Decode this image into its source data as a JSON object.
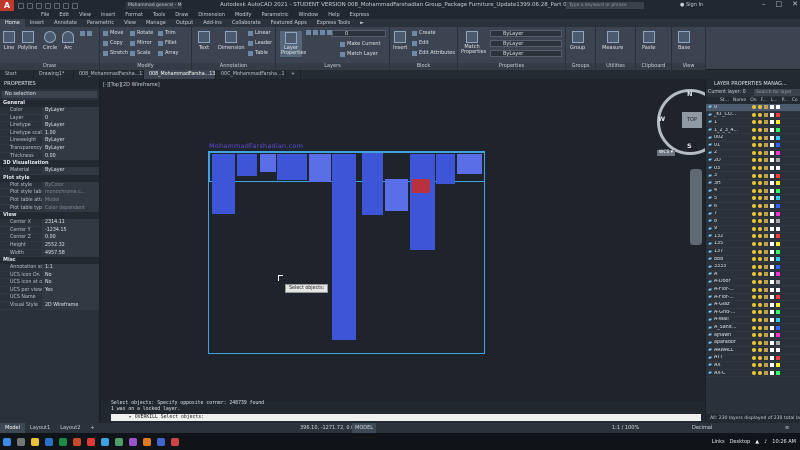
{
  "app": {
    "logo": "A",
    "title": "Autodesk AutoCAD 2021 - STUDENT VERSION    008_MohammadFarshadian Group_Package Furniture_Update1399.06.28_Part 02.dwg",
    "search_placeholder": "Type a keyword or phrase",
    "signin": "Sign In",
    "workspace": "Mohammad general - Mi..."
  },
  "menu": [
    "File",
    "Edit",
    "View",
    "Insert",
    "Format",
    "Tools",
    "Draw",
    "Dimension",
    "Modify",
    "Parametric",
    "Window",
    "Help",
    "Express"
  ],
  "ribbon_tabs": [
    "Home",
    "Insert",
    "Annotate",
    "Parametric",
    "View",
    "Manage",
    "Output",
    "Add-ins",
    "Collaborate",
    "Featured Apps",
    "Express Tools",
    "►"
  ],
  "ribbon": {
    "draw": {
      "label": "Draw",
      "line": "Line",
      "polyline": "Polyline",
      "circle": "Circle",
      "arc": "Arc"
    },
    "modify": {
      "label": "Modify",
      "move": "Move",
      "rotate": "Rotate",
      "trim": "Trim",
      "copy": "Copy",
      "mirror": "Mirror",
      "fillet": "Fillet",
      "stretch": "Stretch",
      "scale": "Scale",
      "array": "Array"
    },
    "annotation": {
      "label": "Annotation",
      "text": "Text",
      "dimension": "Dimension",
      "linear": "Linear",
      "leader": "Leader",
      "table": "Table"
    },
    "layers": {
      "label": "Layers",
      "props": "Layer Properties",
      "combo": "0",
      "make_current": "Make Current",
      "match_layer": "Match Layer"
    },
    "block": {
      "label": "Block",
      "insert": "Insert",
      "create": "Create",
      "edit": "Edit",
      "edit_attr": "Edit Attributes"
    },
    "properties": {
      "label": "Properties",
      "match": "Match Properties",
      "bylayer1": "ByLayer",
      "bylayer2": "ByLayer",
      "bylayer3": "ByLayer"
    },
    "groups": {
      "label": "Groups",
      "group": "Group"
    },
    "utilities": {
      "label": "Utilities",
      "measure": "Measure"
    },
    "clipboard": {
      "label": "Clipboard",
      "paste": "Paste"
    },
    "view": {
      "label": "View",
      "base": "Base"
    }
  },
  "doc_tabs": [
    "Start",
    "Drawing1*",
    "008_MohammadFarsha...1399.06.28_Part 01",
    "008_MohammadFarsha...1399.06.28_Part 02*",
    "00C_MohammadFarsha...1399.06.28_Part 03"
  ],
  "viewport_label": "[-][Top][2D Wireframe]",
  "watermark": "MohammadFarshadian.com",
  "tooltip": "Select objects:",
  "properties": {
    "title": "PROPERTIES",
    "selection": "No selection",
    "sections": [
      {
        "name": "General",
        "rows": [
          [
            "Color",
            "ByLayer"
          ],
          [
            "Layer",
            "0"
          ],
          [
            "Linetype",
            "ByLayer"
          ],
          [
            "Linetype scale",
            "1.00"
          ],
          [
            "Lineweight",
            "ByLayer"
          ],
          [
            "Transparency",
            "ByLayer"
          ],
          [
            "Thickness",
            "0.00"
          ]
        ]
      },
      {
        "name": "3D Visualization",
        "rows": [
          [
            "Material",
            "ByLayer"
          ]
        ]
      },
      {
        "name": "Plot style",
        "rows": [
          [
            "Plot style",
            "ByColor"
          ],
          [
            "Plot style table",
            "monochrome.c..."
          ],
          [
            "Plot table atta...",
            "Model"
          ],
          [
            "Plot table type",
            "Color dependent"
          ]
        ]
      },
      {
        "name": "View",
        "rows": [
          [
            "Center X",
            "2314.11"
          ],
          [
            "Center Y",
            "-1234.15"
          ],
          [
            "Center Z",
            "0.00"
          ],
          [
            "Height",
            "2552.32"
          ],
          [
            "Width",
            "4957.58"
          ]
        ]
      },
      {
        "name": "Misc",
        "rows": [
          [
            "Annotation sc...",
            "1:1"
          ],
          [
            "UCS icon On",
            "No"
          ],
          [
            "UCS icon at or...",
            "No"
          ],
          [
            "UCS per viewp...",
            "Yes"
          ],
          [
            "UCS Name",
            ""
          ],
          [
            "Visual Style",
            "2D Wireframe"
          ]
        ]
      }
    ]
  },
  "navcube": {
    "top": "TOP",
    "n": "N",
    "s": "S",
    "e": "E",
    "w": "W",
    "wcs": "WCS ▾"
  },
  "command": {
    "history": [
      "Select objects: Specify opposite corner: 248739 found",
      "1 was on a locked layer."
    ],
    "prompt": "▸ OVERKILL Select objects:"
  },
  "layer_manager": {
    "title": "LAYER PROPERTIES MANAG...",
    "current": "Current layer: 0",
    "search": "Search for layer",
    "cols": [
      "St...",
      "Name",
      "On",
      "F...",
      "L...",
      "P...",
      "Co"
    ],
    "layers": [
      "0",
      "_KT_CO...",
      "1",
      "1_2_3_4...",
      "002",
      "01",
      "2",
      "2D",
      "03",
      "3",
      "3H",
      "4",
      "5",
      "6",
      "7",
      "8",
      "9",
      "132",
      "135",
      "137",
      "888",
      "3333",
      "A",
      "A-Door",
      "A-Flor-...",
      "A-Flor-...",
      "A-Glaz",
      "A-Grid-...",
      "A-Wall",
      "A_Sanit...",
      "ajhawh",
      "aparador",
      "ARWALL",
      "ATT",
      "AX",
      "AX-C"
    ],
    "footer": "All: 230 layers displayed of 230 total la..."
  },
  "layout_tabs": [
    "Model",
    "Layout1",
    "Layout2",
    "+"
  ],
  "statusbar": {
    "coords": "396.10, -1271.72, 0.00",
    "model": "MODEL",
    "scale": "1:1 / 100%",
    "units": "Decimal"
  },
  "taskbar": {
    "links": "Links",
    "desktop": "Desktop",
    "time": "10:26 AM"
  }
}
